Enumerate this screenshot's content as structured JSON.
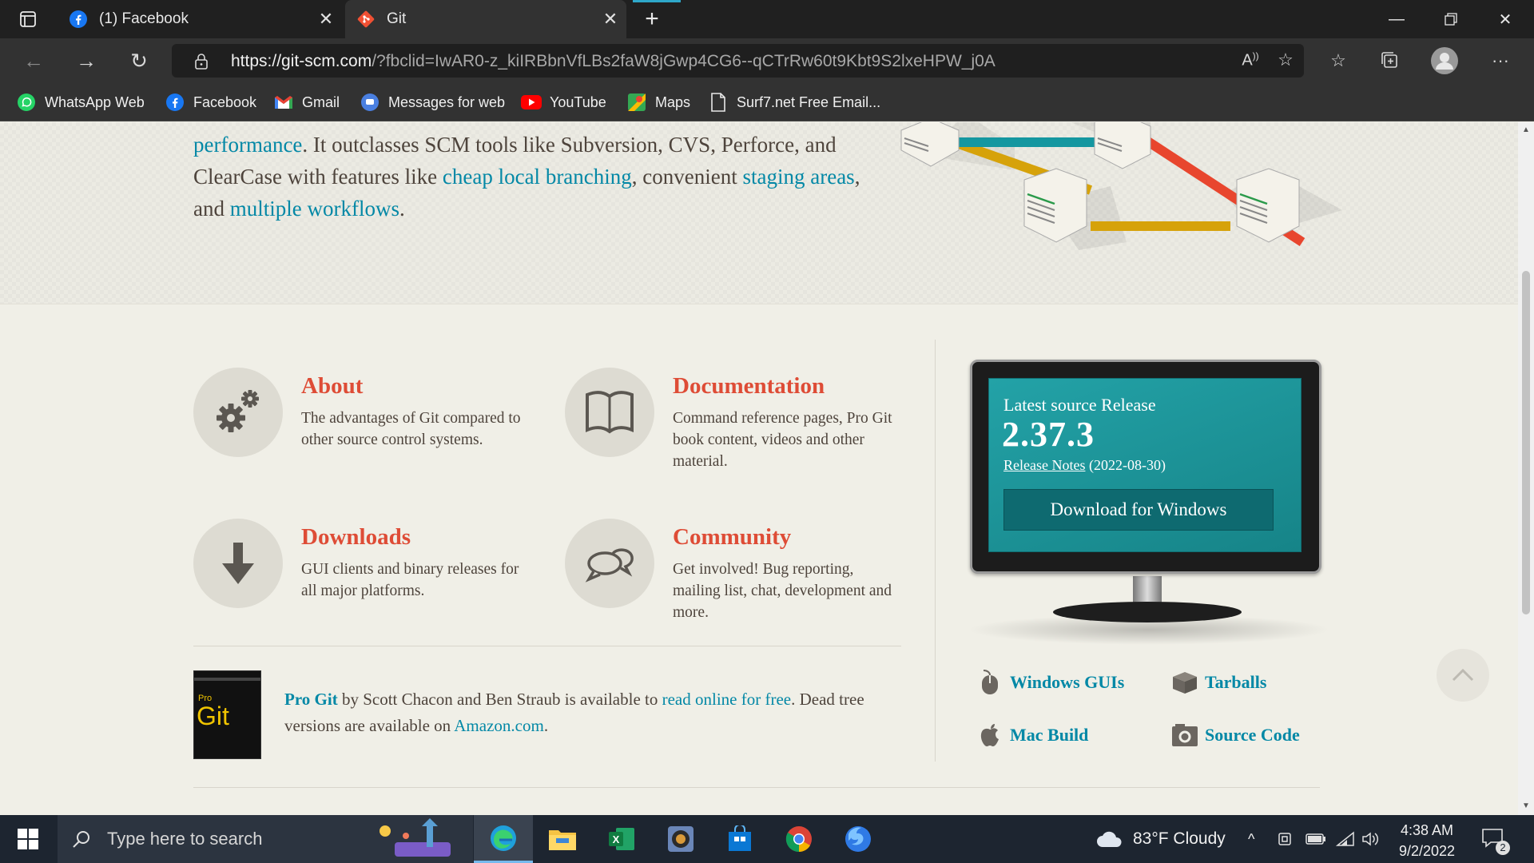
{
  "browser": {
    "tabs": [
      {
        "title": "(1) Facebook",
        "favicon": "facebook-icon",
        "active": false
      },
      {
        "title": "Git",
        "favicon": "git-icon",
        "active": true
      }
    ],
    "url_host": "https://git-scm.com",
    "url_path": "/?fbclid=IwAR0-z_kiIRBbnVfLBs2faW8jGwp4CG6--qCTrRw60t9Kbt9S2lxeHPW_j0A",
    "bookmarks": [
      {
        "label": "WhatsApp Web",
        "icon": "whatsapp-icon"
      },
      {
        "label": "Facebook",
        "icon": "facebook-icon"
      },
      {
        "label": "Gmail",
        "icon": "gmail-icon"
      },
      {
        "label": "Messages for web",
        "icon": "messages-icon"
      },
      {
        "label": "YouTube",
        "icon": "youtube-icon"
      },
      {
        "label": "Maps",
        "icon": "maps-icon"
      },
      {
        "label": "Surf7.net Free Email...",
        "icon": "page-icon"
      }
    ]
  },
  "hero": {
    "link_performance": "performance",
    "text_1": ". It outclasses SCM tools like Subversion, CVS, Perforce, and ClearCase with features like ",
    "link_branching": "cheap local branching",
    "text_2": ", convenient ",
    "link_staging": "staging areas",
    "text_3": ", and ",
    "link_workflows": "multiple workflows",
    "text_4": "."
  },
  "features": [
    {
      "title": "About",
      "desc": "The advantages of Git compared to other source control systems.",
      "icon": "gear-icon"
    },
    {
      "title": "Documentation",
      "desc": "Command reference pages, Pro Git book content, videos and other material.",
      "icon": "book-icon"
    },
    {
      "title": "Downloads",
      "desc": "GUI clients and binary releases for all major platforms.",
      "icon": "download-arrow-icon"
    },
    {
      "title": "Community",
      "desc": "Get involved! Bug reporting, mailing list, chat, development and more.",
      "icon": "chat-bubbles-icon"
    }
  ],
  "progit": {
    "cover_small": "Pro",
    "cover_big": "Git",
    "link_title": "Pro Git",
    "text_1": " by Scott Chacon and Ben Straub is available to ",
    "link_read": "read online for free",
    "text_2": ". Dead tree versions are available on ",
    "link_amazon": "Amazon.com",
    "text_3": "."
  },
  "release": {
    "label": "Latest source Release",
    "version": "2.37.3",
    "notes_link": "Release Notes",
    "date": "(2022-08-30)",
    "download_button": "Download for Windows"
  },
  "download_links": [
    {
      "label": "Windows GUIs",
      "icon": "mouse-icon"
    },
    {
      "label": "Tarballs",
      "icon": "box-icon"
    },
    {
      "label": "Mac Build",
      "icon": "apple-icon"
    },
    {
      "label": "Source Code",
      "icon": "gear-box-icon"
    }
  ],
  "taskbar": {
    "search_placeholder": "Type here to search",
    "weather": "83°F  Cloudy",
    "time": "4:38 AM",
    "date": "9/2/2022",
    "notification_count": "2"
  },
  "colors": {
    "link": "#0388a6",
    "heading": "#de4c36",
    "body_text": "#4e443c",
    "page_bg": "#f0efe7",
    "screen_teal": "#1a8f93"
  }
}
